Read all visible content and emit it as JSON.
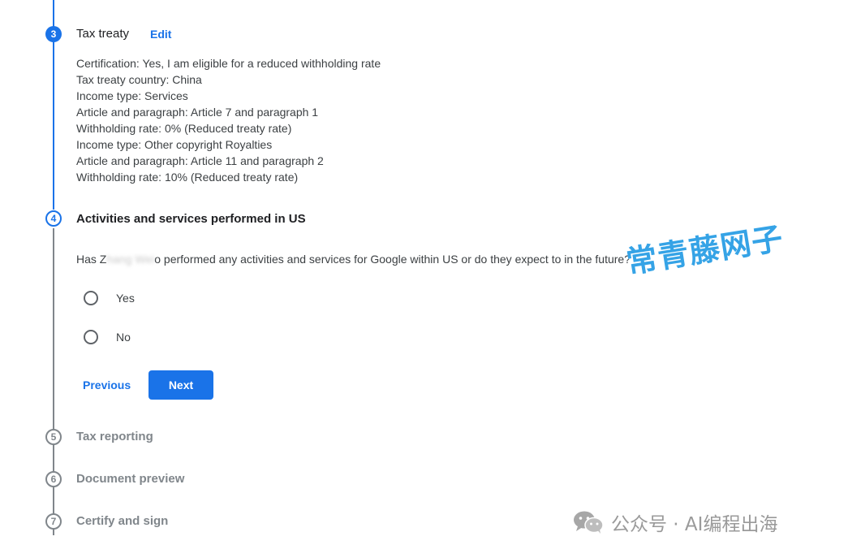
{
  "steps": [
    {
      "number": "3",
      "title": "Tax treaty",
      "status": "done",
      "edit_label": "Edit",
      "summary": [
        "Certification: Yes, I am eligible for a reduced withholding rate",
        "Tax treaty country: China",
        "Income type: Services",
        "Article and paragraph: Article 7 and paragraph 1",
        "Withholding rate: 0% (Reduced treaty rate)",
        "Income type: Other copyright Royalties",
        "Article and paragraph: Article 11 and paragraph 2",
        "Withholding rate: 10% (Reduced treaty rate)"
      ]
    },
    {
      "number": "4",
      "title": "Activities and services performed in US",
      "status": "active"
    },
    {
      "number": "5",
      "title": "Tax reporting",
      "status": "pending"
    },
    {
      "number": "6",
      "title": "Document preview",
      "status": "pending"
    },
    {
      "number": "7",
      "title": "Certify and sign",
      "status": "pending"
    }
  ],
  "question": {
    "prefix": "Has Z",
    "blurred": "hang Wei",
    "suffix": "o performed any activities and services for Google within US or do they expect to in the future?"
  },
  "options": [
    {
      "label": "Yes",
      "selected": false
    },
    {
      "label": "No",
      "selected": false
    }
  ],
  "buttons": {
    "previous": "Previous",
    "next": "Next"
  },
  "watermarks": {
    "overlay": "常青藤网子",
    "footer": "公众号 · AI编程出海"
  },
  "colors": {
    "primary": "#1a73e8",
    "pending": "#80868b"
  }
}
